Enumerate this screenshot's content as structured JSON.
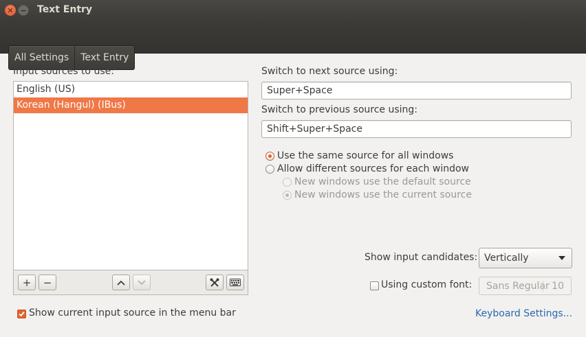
{
  "window": {
    "title": "Text Entry"
  },
  "breadcrumbs": [
    "All Settings",
    "Text Entry"
  ],
  "input_sources": {
    "label": "Input sources to use:",
    "items": [
      "English (US)",
      "Korean (Hangul) (IBus)"
    ],
    "selected_index": 1,
    "tools": {
      "add": "+",
      "remove": "−"
    }
  },
  "switching": {
    "next_label": "Switch to next source using:",
    "next_value": "Super+Space",
    "prev_label": "Switch to previous source using:",
    "prev_value": "Shift+Super+Space"
  },
  "window_mode": {
    "same_label": "Use the same source for all windows",
    "different_label": "Allow different sources for each window",
    "default_label": "New windows use the default source",
    "current_label": "New windows use the current source",
    "selected": "same",
    "sub_selected": "current"
  },
  "candidates": {
    "label": "Show input candidates:",
    "value": "Vertically"
  },
  "custom_font": {
    "label": "Using custom font:",
    "checked": false,
    "font_name": "Sans Regular",
    "font_size": "10"
  },
  "show_in_menu": {
    "label": "Show current input source in the menu bar",
    "checked": true
  },
  "keyboard_settings_link": "Keyboard Settings...",
  "colors": {
    "accent": "#f07746",
    "link": "#2b69ad",
    "titlebar": "#3d3b37"
  },
  "icons": {
    "close": "close-icon",
    "minimize": "minimize-icon",
    "up": "chevron-up-icon",
    "down": "chevron-down-icon",
    "configure": "tools-icon",
    "keyboard": "keyboard-icon"
  }
}
